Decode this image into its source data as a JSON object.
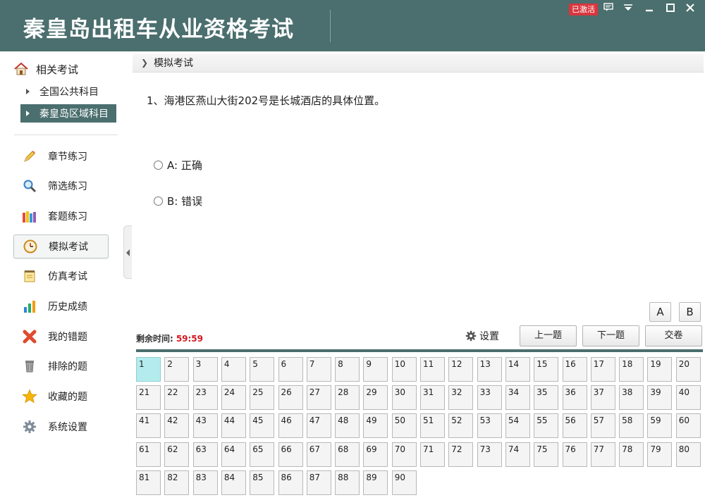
{
  "header": {
    "title": "秦皇岛出租车从业资格考试",
    "badge": "已激活",
    "controls": [
      "message-icon",
      "dropdown-icon",
      "minimize-icon",
      "maximize-icon",
      "close-icon"
    ]
  },
  "sidebar": {
    "related_label": "相关考试",
    "sub_items": [
      {
        "label": "全国公共科目",
        "active": false
      },
      {
        "label": "秦皇岛区域科目",
        "active": true
      }
    ],
    "items": [
      {
        "label": "章节练习",
        "icon": "pencil-icon"
      },
      {
        "label": "筛选练习",
        "icon": "magnifier-icon"
      },
      {
        "label": "套题练习",
        "icon": "books-icon"
      },
      {
        "label": "模拟考试",
        "icon": "clock-icon",
        "active": true
      },
      {
        "label": "仿真考试",
        "icon": "notepad-icon"
      },
      {
        "label": "历史成绩",
        "icon": "bar-chart-icon"
      },
      {
        "label": "我的错题",
        "icon": "red-x-icon"
      },
      {
        "label": "排除的题",
        "icon": "trash-icon"
      },
      {
        "label": "收藏的题",
        "icon": "star-icon"
      },
      {
        "label": "系统设置",
        "icon": "gear-icon"
      }
    ]
  },
  "main": {
    "breadcrumb": "模拟考试",
    "question": "1、海港区燕山大街202号是长城酒店的具体位置。",
    "options": [
      {
        "label": "A: 正确",
        "selected": false
      },
      {
        "label": "B: 错误",
        "selected": false
      }
    ],
    "font_buttons": [
      "A",
      "B"
    ],
    "timer_label": "剩余时间:",
    "timer_value": "59:59",
    "settings_label": "设置",
    "prev_label": "上一题",
    "next_label": "下一题",
    "submit_label": "交卷",
    "current_question": 1,
    "total_questions": 90
  },
  "colors": {
    "header": "#4b6e6e",
    "accent": "#4b6e6e",
    "timer": "#d71920",
    "badge": "#d9363e",
    "current_cell": "#b4ecee"
  }
}
